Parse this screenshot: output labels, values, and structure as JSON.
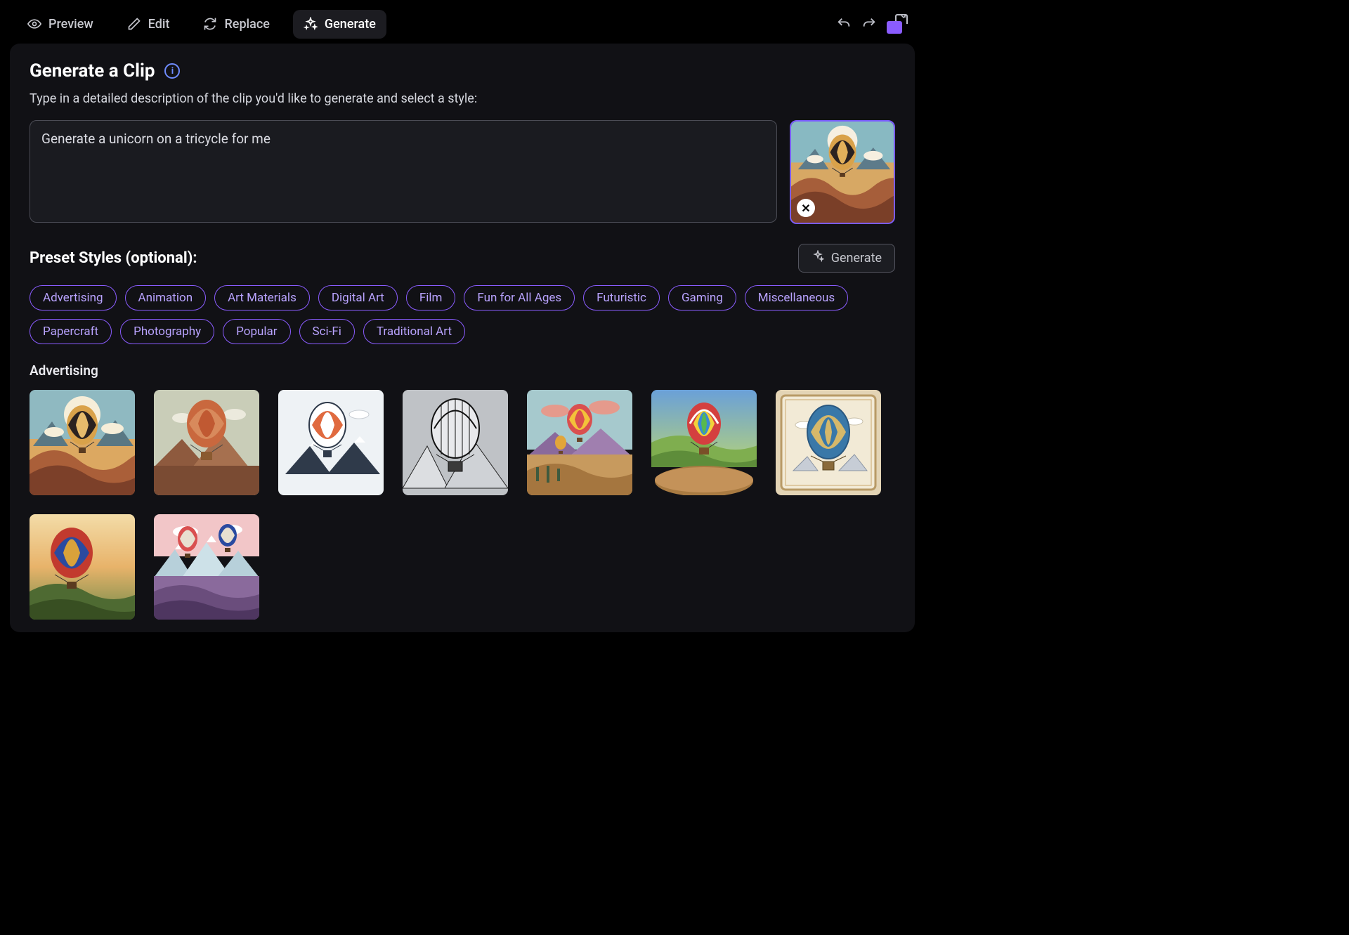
{
  "tabs": {
    "preview": "Preview",
    "edit": "Edit",
    "replace": "Replace",
    "generate": "Generate"
  },
  "page": {
    "title": "Generate a Clip",
    "subtitle": "Type in a detailed description of the clip you'd like to generate and select a style:"
  },
  "prompt": {
    "value": "Generate a unicorn on a tricycle for me"
  },
  "preset": {
    "title": "Preset Styles (optional):",
    "generate_label": "Generate",
    "categories": [
      "Advertising",
      "Animation",
      "Art Materials",
      "Digital Art",
      "Film",
      "Fun for All Ages",
      "Futuristic",
      "Gaming",
      "Miscellaneous",
      "Papercraft",
      "Photography",
      "Popular",
      "Sci-Fi",
      "Traditional Art"
    ]
  },
  "gallery": {
    "section_label": "Advertising"
  }
}
